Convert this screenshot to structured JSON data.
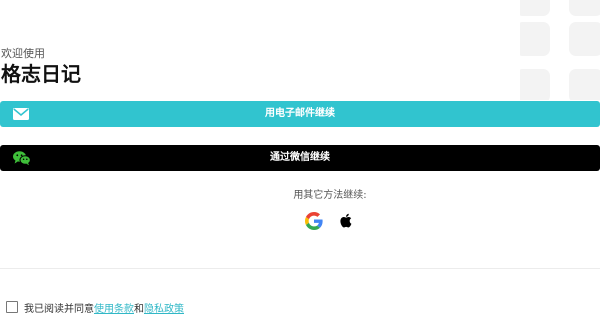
{
  "header": {
    "welcome": "欢迎使用",
    "app_name": "格志日记"
  },
  "buttons": {
    "email": {
      "label": "用电子邮件继续",
      "icon": "envelope-icon",
      "color": "#31c4cf"
    },
    "wechat": {
      "label": "通过微信继续",
      "icon": "wechat-icon",
      "color": "#000000"
    }
  },
  "alternatives": {
    "label": "用其它方法继续:",
    "providers": [
      {
        "name": "google",
        "icon": "google-icon"
      },
      {
        "name": "apple",
        "icon": "apple-icon"
      }
    ]
  },
  "consent": {
    "prefix": "我已阅读并同意",
    "terms": "使用条款",
    "conjunction": "和",
    "privacy": "隐私政策",
    "checked": false,
    "link_color": "#31b8c7"
  }
}
